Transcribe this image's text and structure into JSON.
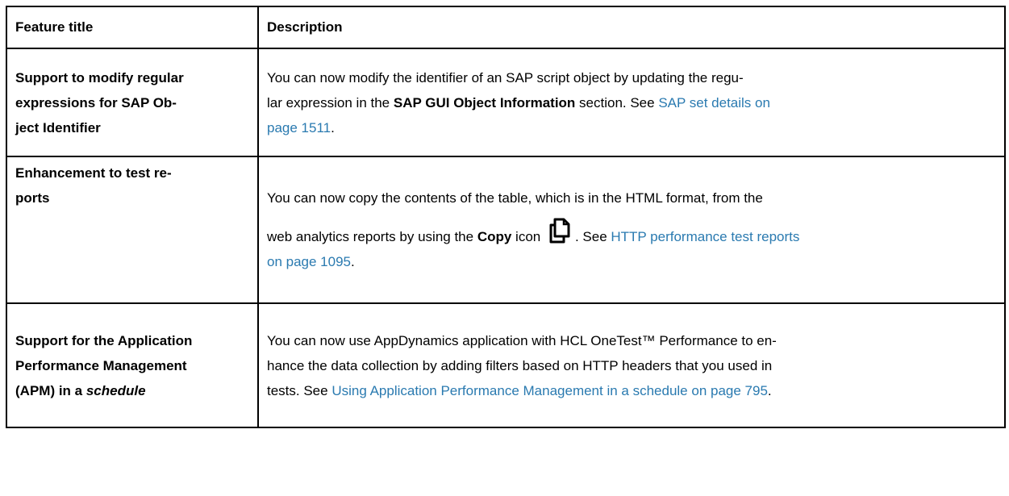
{
  "table": {
    "headers": [
      "Feature title",
      "Description"
    ],
    "rows": [
      {
        "title_lines": [
          "Support to modify regular",
          "expressions for SAP Ob-",
          "ject Identifier"
        ],
        "desc": {
          "line1": "You can now modify the identifier of an SAP script object by updating the regu-",
          "line2_pre": "lar expression in the ",
          "line2_bold": "SAP GUI Object Information",
          "line2_post": " section. See ",
          "link_part1": "SAP set details on",
          "link_part2": "page 1511",
          "line3_post": "."
        }
      },
      {
        "title_lines": [
          "Enhancement to test re-",
          "ports"
        ],
        "desc": {
          "line1": "You can now copy the contents of the table, which is in the HTML format, from the",
          "line2_pre": "web analytics reports by using the ",
          "line2_bold": "Copy",
          "line2_mid": " icon ",
          "icon": "copy-icon",
          "line2_post": ". See ",
          "link_part1": "HTTP performance test reports",
          "link_part2": "on page 1095",
          "line3_post": "."
        }
      },
      {
        "title_lines": [
          "Support for the Application",
          "Performance Management",
          "(APM) in a "
        ],
        "title_italic": "schedule",
        "desc": {
          "line1": "You can now use AppDynamics application with HCL OneTest™ Performance to en-",
          "line2": "hance the data collection by adding filters based on HTTP headers that you used in",
          "line3_pre": "tests. See ",
          "link": "Using Application Performance Management in a schedule on page 795",
          "line3_post": "."
        }
      }
    ]
  }
}
